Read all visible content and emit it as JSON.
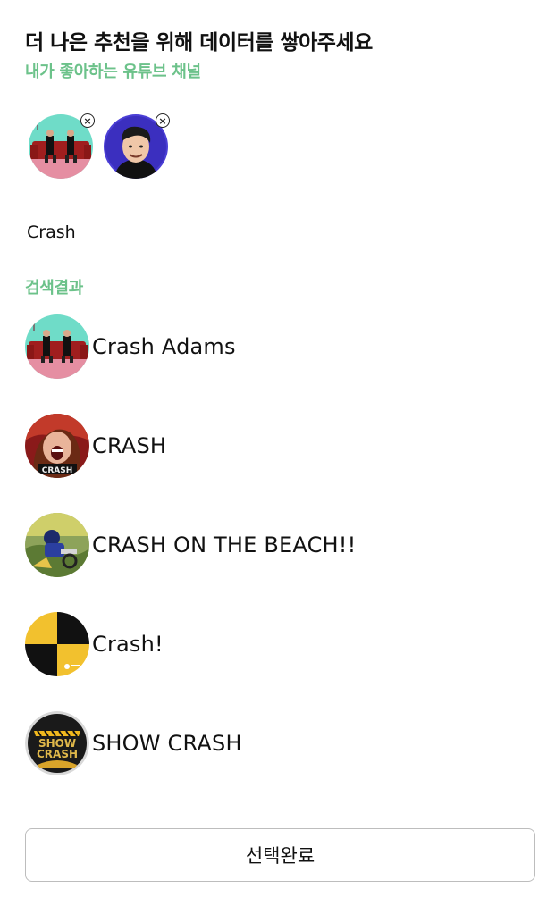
{
  "header": {
    "title": "더 나은 추천을 위해 데이터를 쌓아주세요",
    "subtitle": "내가 좋아하는 유튜브 채널"
  },
  "selected_channels": [
    {
      "avatar_icon": "duo-on-couch-avatar-icon"
    },
    {
      "avatar_icon": "cartoon-man-avatar-icon"
    }
  ],
  "search": {
    "value": "Crash",
    "placeholder": ""
  },
  "results": {
    "label": "검색결과",
    "items": [
      {
        "name": "Crash Adams",
        "avatar_icon": "duo-on-couch-avatar-icon"
      },
      {
        "name": "CRASH",
        "avatar_icon": "screaming-woman-avatar-icon"
      },
      {
        "name": "CRASH ON THE BEACH!!",
        "avatar_icon": "motorcycle-crash-avatar-icon"
      },
      {
        "name": "Crash!",
        "avatar_icon": "crash-test-marker-avatar-icon"
      },
      {
        "name": "SHOW CRASH",
        "avatar_icon": "show-crash-logo-avatar-icon"
      }
    ]
  },
  "footer": {
    "complete_label": "선택완료"
  },
  "colors": {
    "accent_green": "#6cc28a",
    "button_border": "#bdbdbd"
  }
}
